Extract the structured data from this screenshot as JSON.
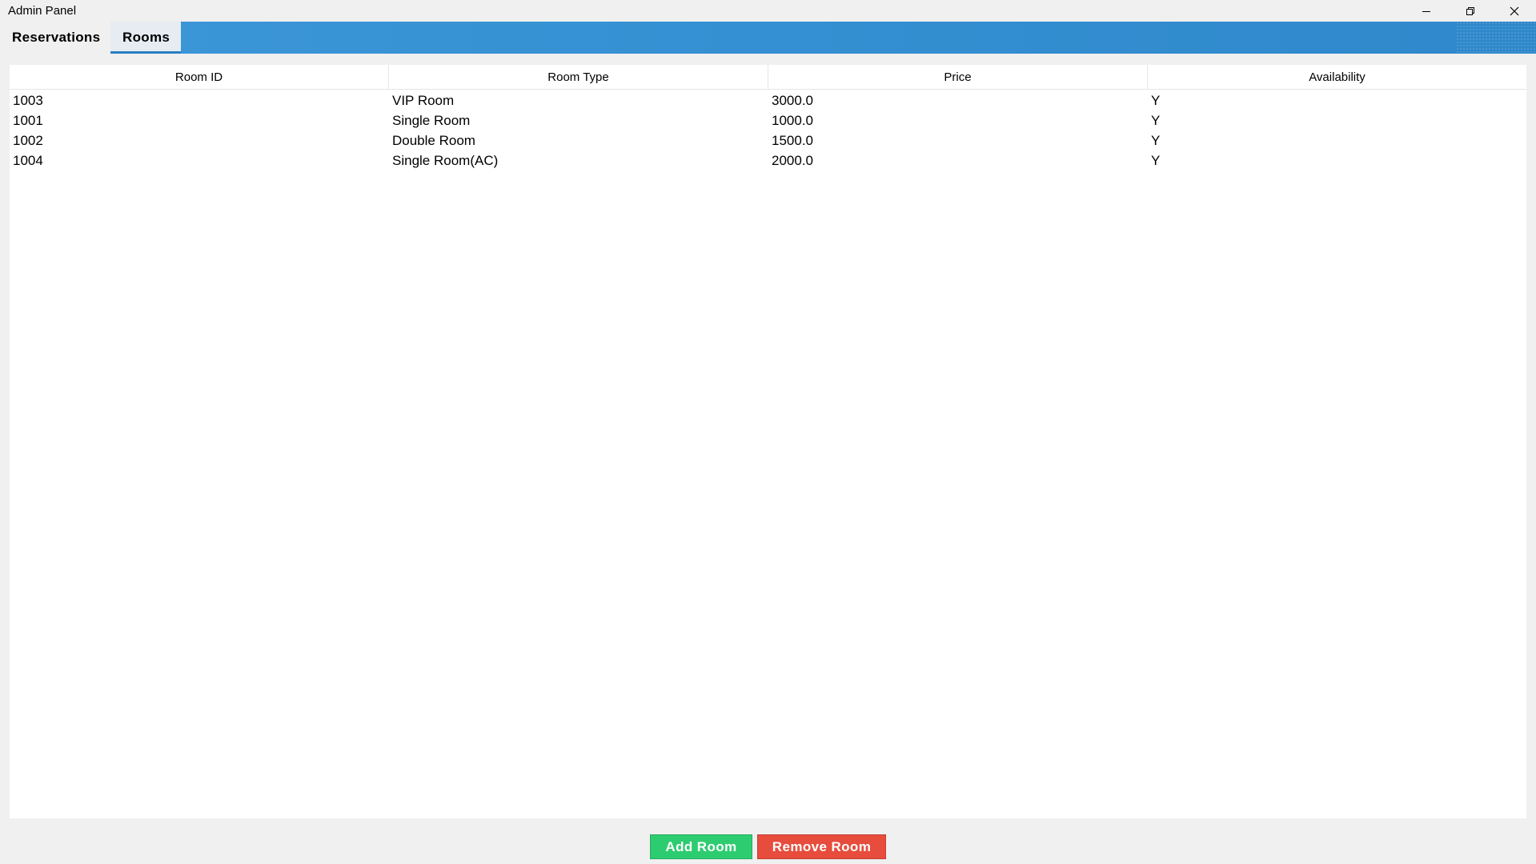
{
  "window": {
    "title": "Admin Panel",
    "controls": [
      "minimize-icon",
      "restore-icon",
      "close-icon"
    ]
  },
  "tabs": [
    {
      "label": "Reservations",
      "selected": false
    },
    {
      "label": "Rooms",
      "selected": true
    }
  ],
  "table": {
    "headers": [
      "Room ID",
      "Room Type",
      "Price",
      "Availability"
    ],
    "rows": [
      [
        "1003",
        "VIP Room",
        "3000.0",
        "Y"
      ],
      [
        "1001",
        "Single Room",
        "1000.0",
        "Y"
      ],
      [
        "1002",
        "Double Room",
        "1500.0",
        "Y"
      ],
      [
        "1004",
        "Single Room(AC)",
        "2000.0",
        "Y"
      ]
    ]
  },
  "actions": {
    "add_label": "Add Room",
    "remove_label": "Remove Room"
  },
  "colors": {
    "accent": "#3490d2",
    "add": "#2ecc71",
    "remove": "#e74c3c"
  }
}
